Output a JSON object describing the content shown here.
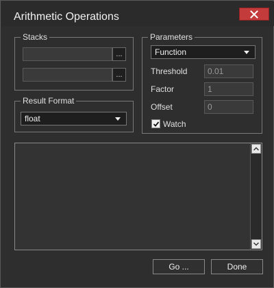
{
  "window": {
    "title": "Arithmetic Operations"
  },
  "stacks": {
    "legend": "Stacks",
    "stack1": {
      "value": "",
      "browse_label": "..."
    },
    "stack2": {
      "value": "",
      "browse_label": "..."
    }
  },
  "result_format": {
    "legend": "Result Format",
    "selected": "float"
  },
  "parameters": {
    "legend": "Parameters",
    "function": {
      "selected": "Function"
    },
    "threshold": {
      "label": "Threshold",
      "value": "0.01"
    },
    "factor": {
      "label": "Factor",
      "value": "1"
    },
    "offset": {
      "label": "Offset",
      "value": "0"
    },
    "watch": {
      "label": "Watch",
      "checked": true
    }
  },
  "log": {
    "text": ""
  },
  "buttons": {
    "go_label": "Go ...",
    "done_label": "Done"
  },
  "colors": {
    "close_button": "#c43b3b",
    "background": "#2e2e2e"
  }
}
